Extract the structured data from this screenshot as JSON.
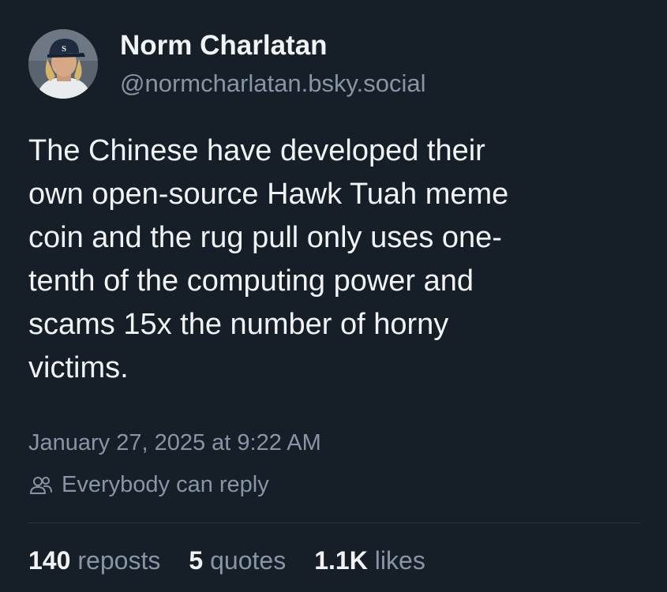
{
  "author": {
    "display_name": "Norm Charlatan",
    "handle": "@normcharlatan.bsky.social",
    "avatar_icon": "baseball-player-avatar-icon"
  },
  "post": {
    "lines": [
      "The Chinese have developed their",
      "own open-source Hawk Tuah meme",
      "coin and the rug pull only uses one-",
      "tenth of the computing power and",
      "scams 15x the number of horny",
      "victims."
    ]
  },
  "meta": {
    "timestamp": "January 27, 2025 at 9:22 AM",
    "reply_setting": "Everybody can reply",
    "reply_icon": "people-icon"
  },
  "stats": {
    "reposts_count": "140",
    "reposts_label": "reposts",
    "quotes_count": "5",
    "quotes_label": "quotes",
    "likes_count": "1.1K",
    "likes_label": "likes"
  },
  "colors": {
    "background": "#161e27",
    "primary_text": "#f1f3f5",
    "secondary_text": "#8795a6",
    "divider": "#2a3440"
  }
}
